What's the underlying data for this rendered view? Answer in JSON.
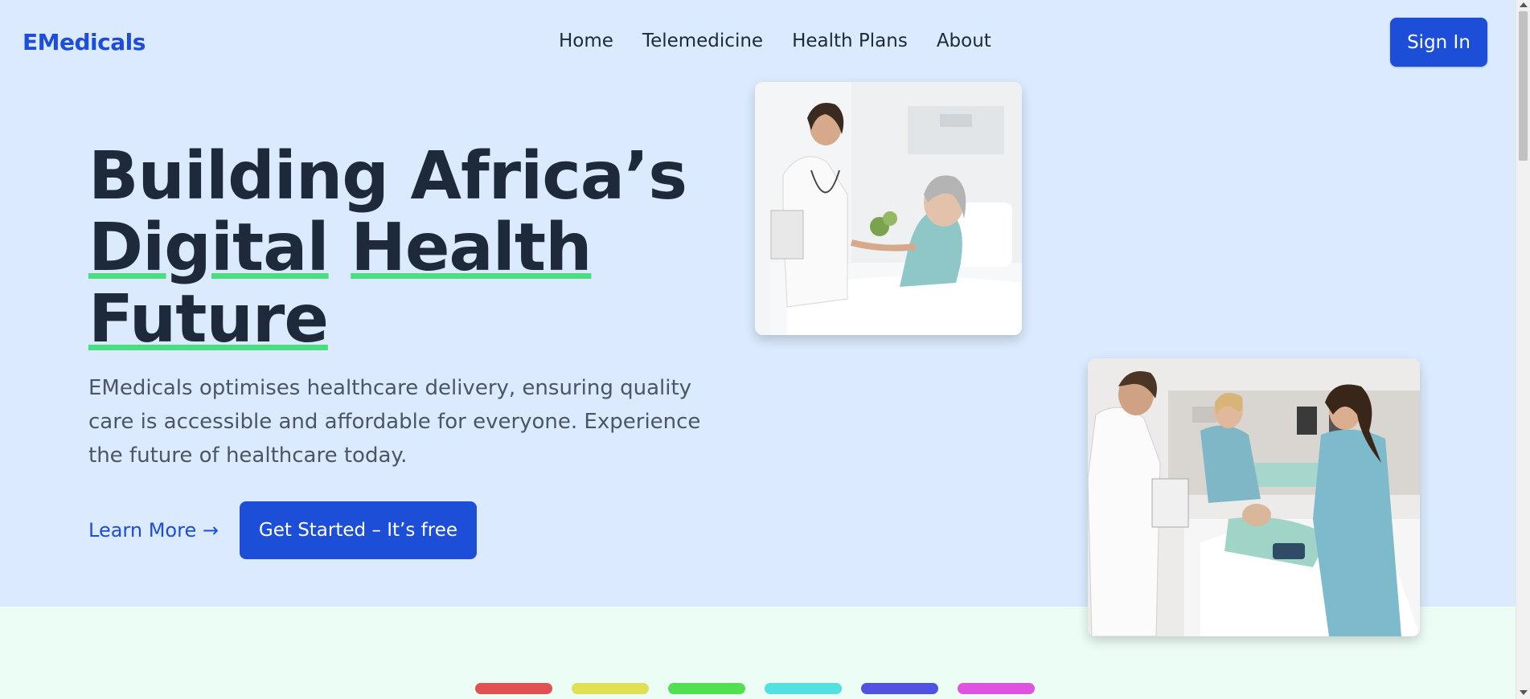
{
  "brand": {
    "name": "EMedicals"
  },
  "nav": {
    "items": [
      {
        "label": "Home"
      },
      {
        "label": "Telemedicine"
      },
      {
        "label": "Health Plans"
      },
      {
        "label": "About"
      }
    ],
    "signin_label": "Sign In"
  },
  "hero": {
    "headline_line1": "Building Africa’s",
    "headline_line2a": "Digital",
    "headline_line2b": "Health",
    "headline_line3": "Future",
    "subtext": "EMedicals optimises healthcare delivery, ensuring quality care is accessible and affordable for everyone. Experience the future of healthcare today.",
    "learn_more_label": "Learn More →",
    "get_started_label": "Get Started – It’s free"
  },
  "images": [
    {
      "icon": "doctor-with-patient-photo"
    },
    {
      "icon": "medical-team-emergency-photo"
    }
  ],
  "decorative_bars": [
    "#e05252",
    "#e0e052",
    "#52e052",
    "#52e0e0",
    "#5252e0",
    "#e052e0"
  ],
  "colors": {
    "brand_blue": "#1d4ed8",
    "hero_bg": "#dbeafe",
    "lower_bg": "#ecfdf5",
    "underline_green": "#4ade80",
    "headline_text": "#1e293b"
  }
}
